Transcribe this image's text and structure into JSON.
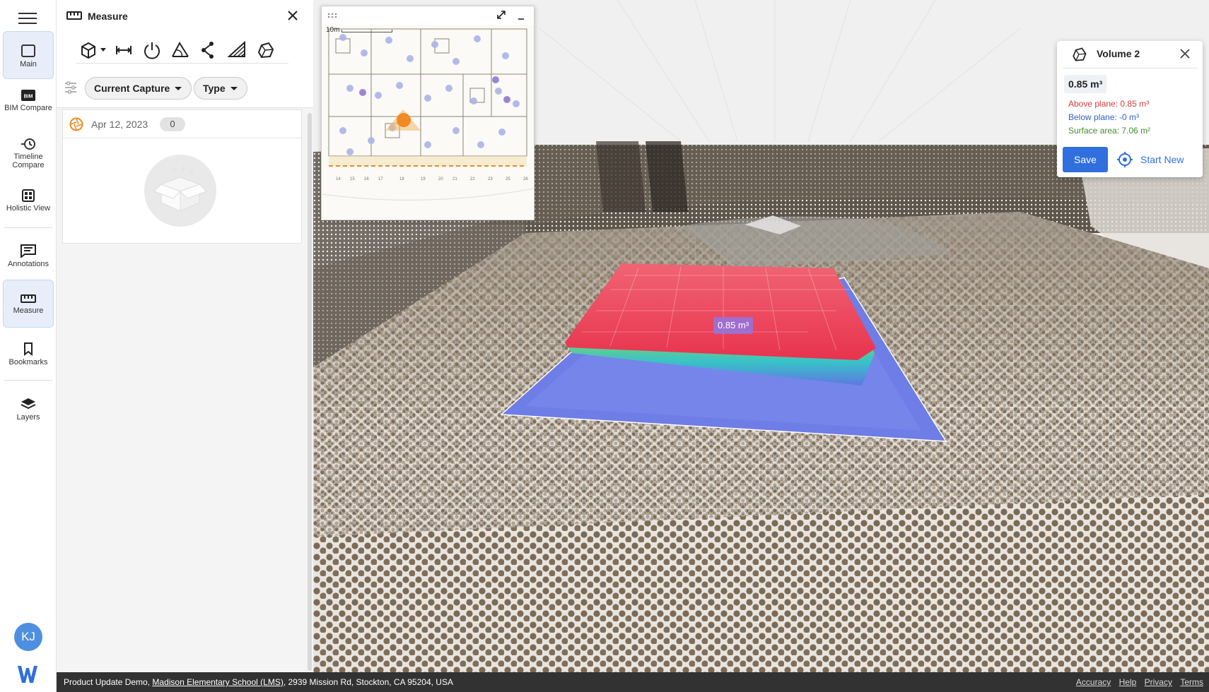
{
  "rail": {
    "items": [
      {
        "label": "Main",
        "icon": "square-icon",
        "active": true
      },
      {
        "label": "BIM Compare",
        "icon": "bim-icon"
      },
      {
        "label": "Timeline Compare",
        "icon": "timeline-icon"
      },
      {
        "label": "Holistic View",
        "icon": "grid-icon"
      },
      {
        "label": "Annotations",
        "icon": "annotation-icon"
      },
      {
        "label": "Measure",
        "icon": "ruler-icon",
        "active": true
      },
      {
        "label": "Bookmarks",
        "icon": "bookmark-icon"
      },
      {
        "label": "Layers",
        "icon": "layers-icon"
      }
    ],
    "avatar_initials": "KJ"
  },
  "panel": {
    "title": "Measure",
    "filters": {
      "capture": "Current Capture",
      "type": "Type"
    },
    "capture": {
      "date": "Apr 12, 2023",
      "count": "0"
    }
  },
  "viewer": {
    "volume_label": "0.85 m³"
  },
  "volume_card": {
    "title": "Volume 2",
    "total": "0.85 m³",
    "above": "Above plane: 0.85 m³",
    "below": "Below plane: -0 m³",
    "surface": "Surface area: 7.06 m²",
    "save": "Save",
    "start_new": "Start New",
    "colors": {
      "above": "#d83a3a",
      "below": "#2f5fc8",
      "surface": "#3f8f2c",
      "accent": "#2f6fde"
    }
  },
  "minimap": {
    "scale": "10m"
  },
  "footer": {
    "project": "Product Update Demo,",
    "site_link": "Madison Elementary School (LMS)",
    "address": ", 2939 Mission Rd, Stockton, CA 95204, USA",
    "links": {
      "accuracy": "Accuracy",
      "help": "Help",
      "privacy": "Privacy",
      "terms": "Terms"
    }
  }
}
